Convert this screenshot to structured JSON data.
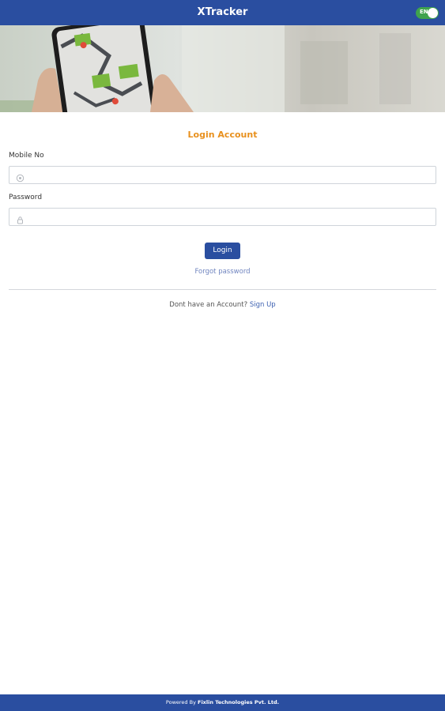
{
  "header": {
    "title": "XTracker",
    "language_toggle": "EN"
  },
  "login": {
    "title": "Login Account",
    "mobile_label": "Mobile No",
    "mobile_value": "",
    "password_label": "Password",
    "password_value": "",
    "login_button": "Login",
    "forgot_password": "Forgot password",
    "no_account_text": "Dont have an Account?",
    "signup_link": "Sign Up"
  },
  "footer": {
    "powered_by": "Powered By",
    "company": "Fixlin Technologies Pvt. Ltd."
  },
  "icons": {
    "mobile_field": "phone-icon",
    "password_field": "lock-icon"
  },
  "colors": {
    "primary": "#2a4ea0",
    "accent": "#e8901d",
    "toggle": "#3fa34d"
  }
}
